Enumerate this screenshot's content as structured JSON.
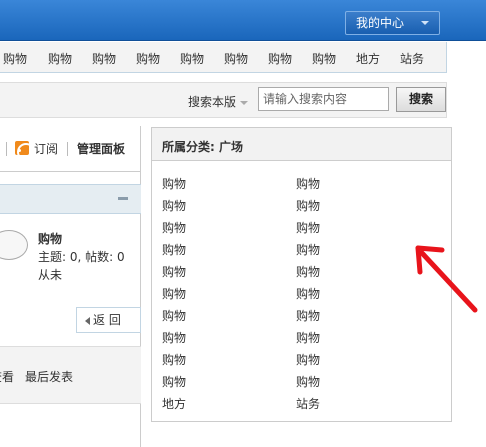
{
  "topbar": {
    "user_center_label": "我的中心"
  },
  "nav": {
    "items": [
      "购物",
      "购物",
      "购物",
      "购物",
      "购物",
      "购物",
      "购物",
      "购物",
      "地方",
      "站务"
    ]
  },
  "search": {
    "scope_label": "搜索本版",
    "placeholder": "请输入搜索内容",
    "button_label": "搜索"
  },
  "toolbar": {
    "subscribe_label": "订阅",
    "manage_label": "管理面板"
  },
  "forum": {
    "name": "购物",
    "stats": "主题: 0, 帖数: 0",
    "last_post": "从未"
  },
  "back_button_label": "返 回",
  "sort_bar": {
    "view_label": "查看",
    "latest_label": "最后发表"
  },
  "category": {
    "title": "所属分类: 广场",
    "left_column": [
      "购物",
      "购物",
      "购物",
      "购物",
      "购物",
      "购物",
      "购物",
      "购物",
      "购物",
      "购物",
      "地方"
    ],
    "right_column": [
      "购物",
      "购物",
      "购物",
      "购物",
      "购物",
      "购物",
      "购物",
      "购物",
      "购物",
      "购物",
      "站务"
    ]
  },
  "colors": {
    "topbar": "#2a75c8",
    "accent_border": "#c2d5e3",
    "annotation_arrow": "#e8141b"
  },
  "icons": [
    "chevron-down-icon",
    "rss-icon",
    "minus-icon",
    "speech-bubble-icon",
    "back-arrow-icon",
    "annotation-arrow-icon"
  ]
}
